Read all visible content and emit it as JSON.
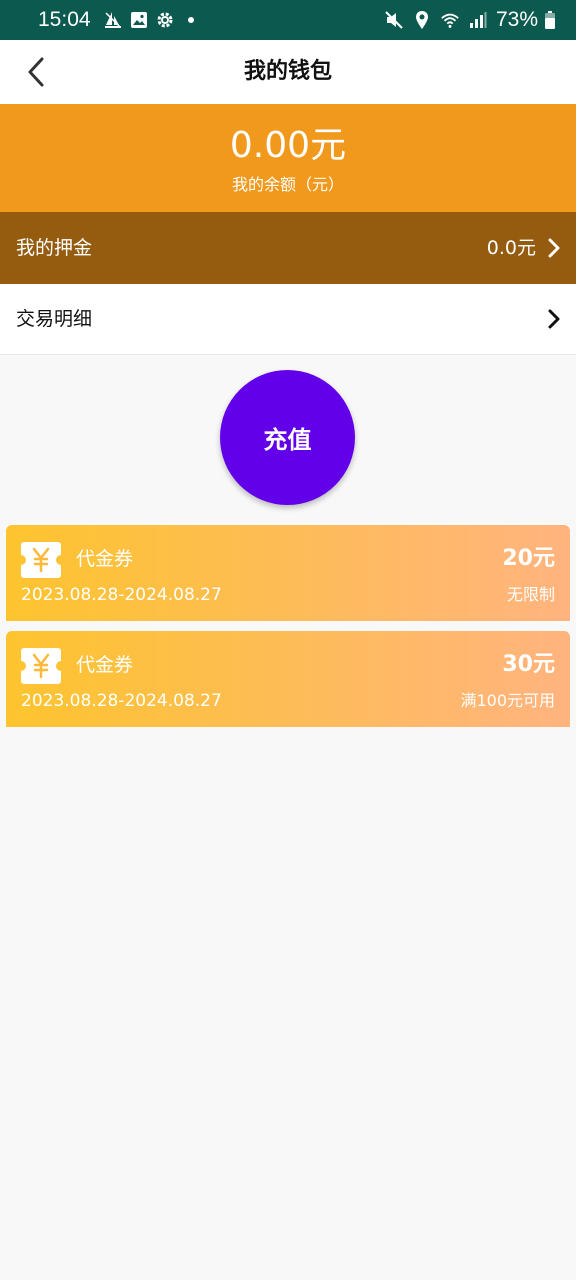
{
  "status_bar": {
    "time": "15:04",
    "battery": "73%",
    "icons_left": [
      "sailboat-icon",
      "image-icon",
      "gear-icon",
      "dot-icon"
    ],
    "icons_right": [
      "mute-icon",
      "location-icon",
      "wifi-icon",
      "signal-icon",
      "battery-icon"
    ]
  },
  "header": {
    "title": "我的钱包",
    "back_icon": "chevron-left-icon"
  },
  "balance": {
    "amount": "0.00元",
    "label": "我的余额（元）"
  },
  "deposit": {
    "label": "我的押金",
    "value": "0.0元"
  },
  "transactions": {
    "label": "交易明细"
  },
  "recharge_button": {
    "label": "充值"
  },
  "coupons": [
    {
      "name": "代金券",
      "value": "20元",
      "date_range": "2023.08.28-2024.08.27",
      "condition": "无限制"
    },
    {
      "name": "代金券",
      "value": "30元",
      "date_range": "2023.08.28-2024.08.27",
      "condition": "满100元可用"
    }
  ],
  "colors": {
    "status_bar": "#0c5a4f",
    "balance_bg": "#f0991d",
    "deposit_bg": "#955c0f",
    "recharge_bg": "#6200ea",
    "coupon_start": "#fec42f",
    "coupon_end": "#ffb47f"
  }
}
